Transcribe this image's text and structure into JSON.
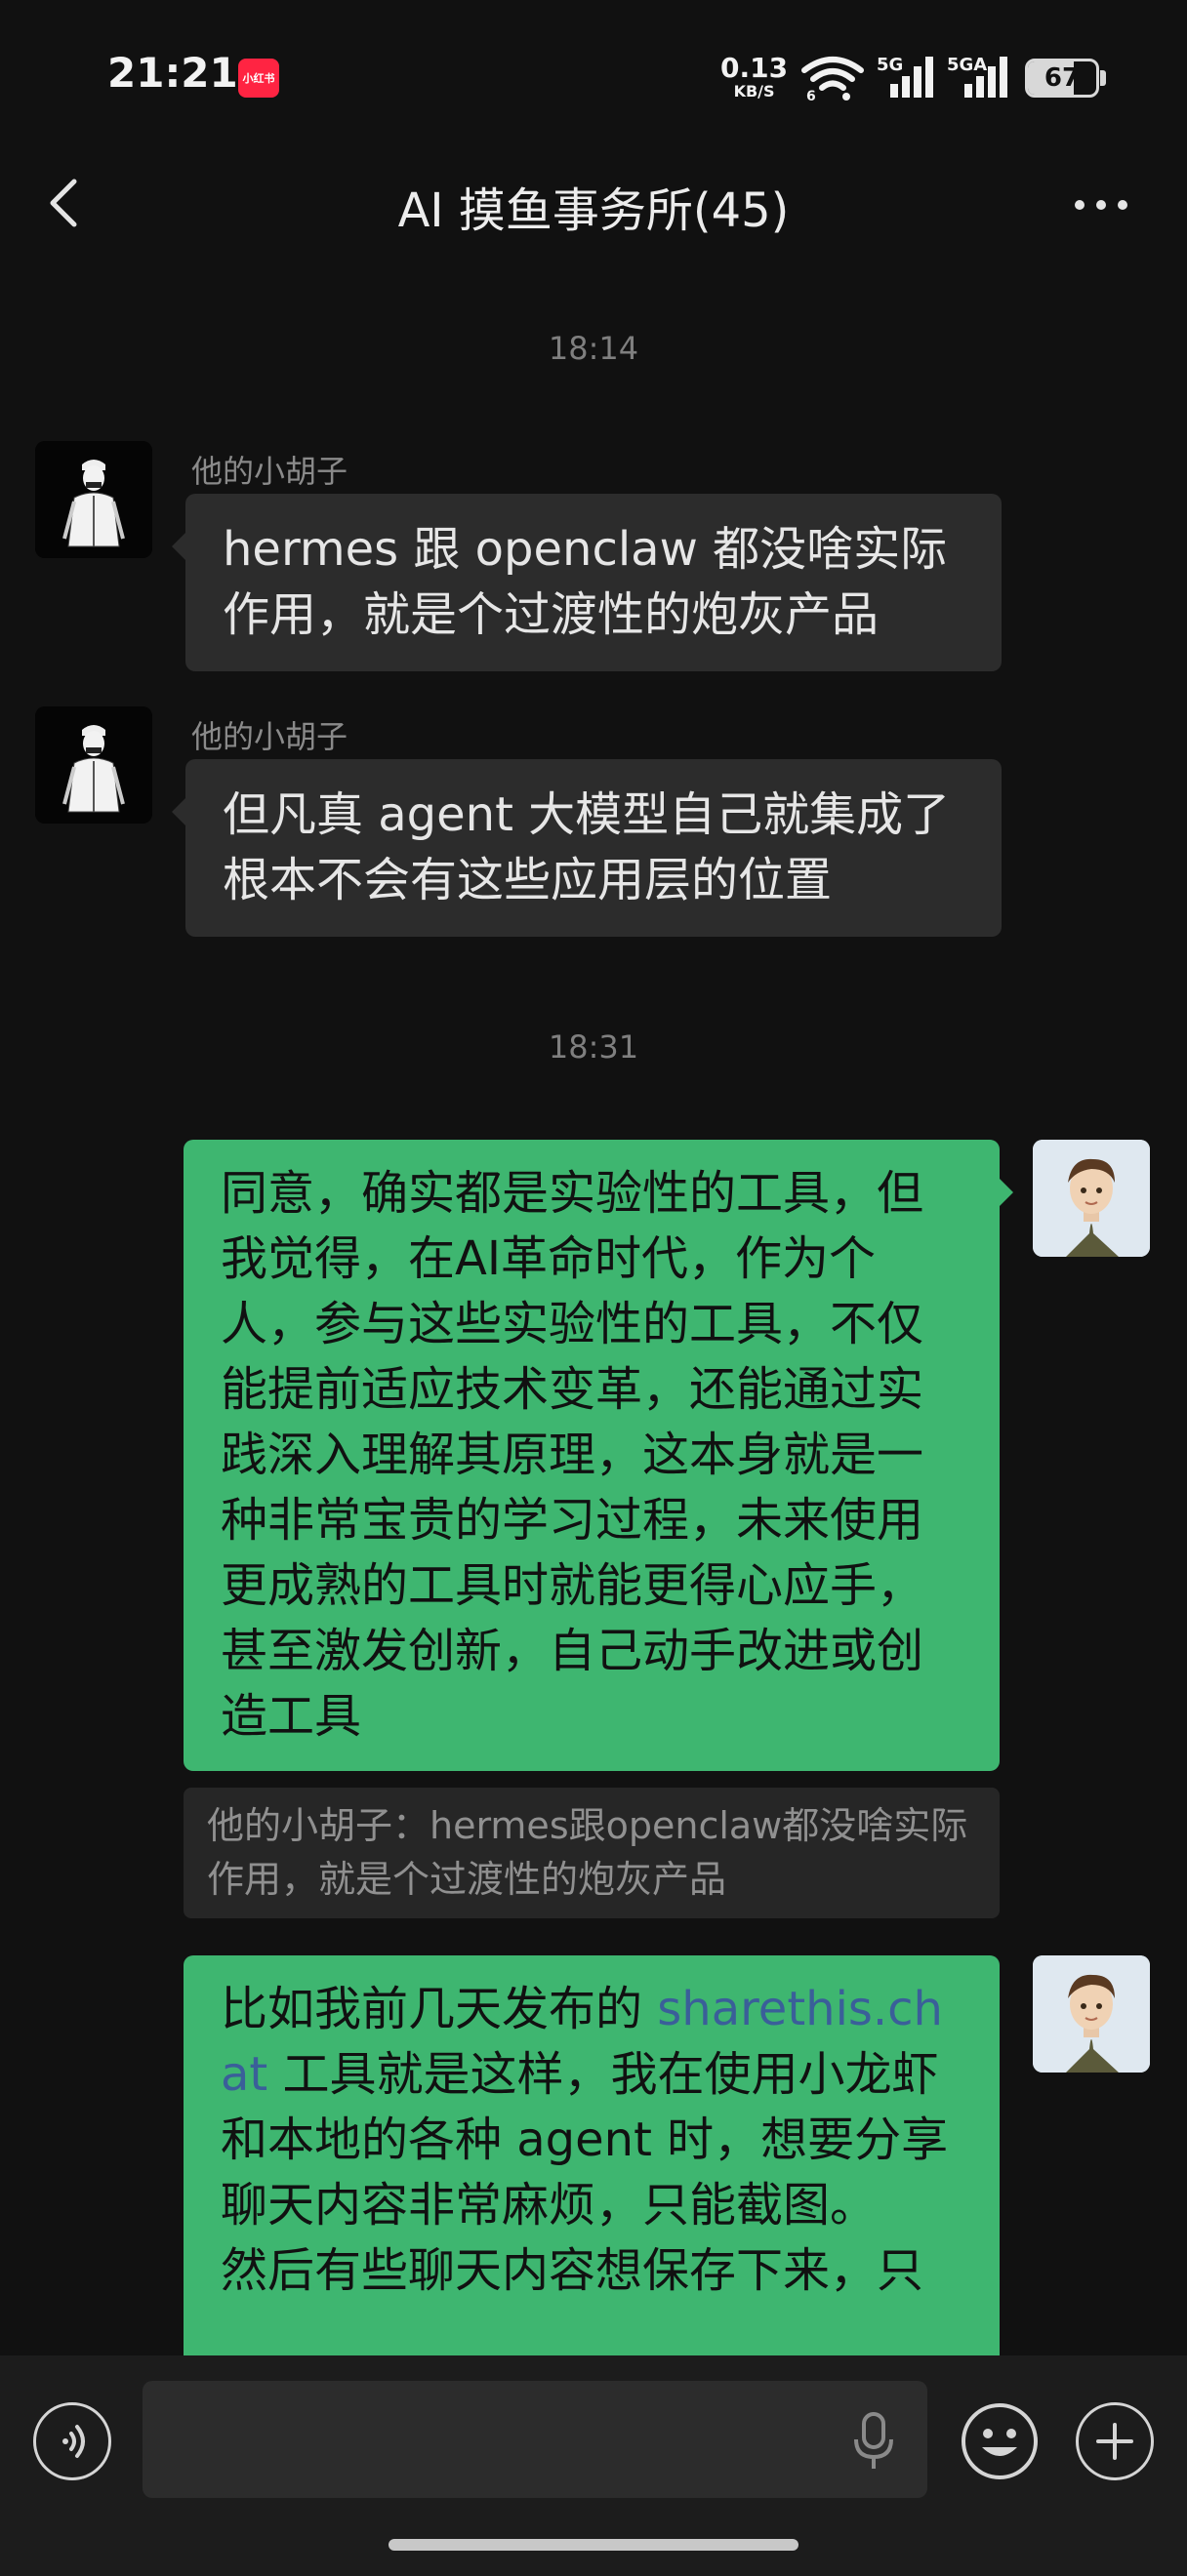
{
  "status_bar": {
    "time": "21:21",
    "app_badge": "小红书",
    "net_speed": "0.13",
    "net_speed_unit": "KB/S",
    "wifi_sub": "6",
    "signal1_label": "5G",
    "signal2_label": "5GA",
    "battery": "67",
    "battery_level": 0.67
  },
  "header": {
    "title": "AI 摸鱼事务所(45)"
  },
  "messages": [
    {
      "type": "timestamp",
      "text": "18:14"
    },
    {
      "type": "incoming",
      "sender": "他的小胡子",
      "text": "hermes 跟 openclaw 都没啥实际作用，就是个过渡性的炮灰产品"
    },
    {
      "type": "incoming",
      "sender": "他的小胡子",
      "text": "但凡真 agent  大模型自己就集成了  根本不会有这些应用层的位置"
    },
    {
      "type": "timestamp",
      "text": "18:31"
    },
    {
      "type": "outgoing",
      "text": "同意，确实都是实验性的工具，但我觉得，在AI革命时代，作为个人，参与这些实验性的工具，不仅能提前适应技术变革，还能通过实践深入理解其原理，这本身就是一种非常宝贵的学习过程，未来使用更成熟的工具时就能更得心应手，甚至激发创新，自己动手改进或创造工具"
    },
    {
      "type": "quote",
      "text": "他的小胡子：hermes跟openclaw都没啥实际作用，就是个过渡性的炮灰产品"
    },
    {
      "type": "outgoing",
      "text_before_link": "比如我前几天发布的 ",
      "link": "sharethis.chat",
      "text_after_link": " 工具就是这样，我在使用小龙虾和本地的各种 agent 时，想要分享聊天内容非常麻烦，只能截图。",
      "text_cont": "然后有些聊天内容想保存下来，只"
    }
  ],
  "input": {
    "placeholder": ""
  },
  "colors": {
    "background": "#111111",
    "outgoing_bubble": "#3eb670",
    "incoming_bubble": "#2c2c2c",
    "link": "#3a5f99",
    "app_badge": "#ff2442"
  },
  "icons": {
    "back": "back-arrow-icon",
    "more": "more-dots-icon",
    "voice": "voice-icon",
    "mic": "microphone-icon",
    "emoji": "emoji-icon",
    "plus": "plus-icon"
  }
}
